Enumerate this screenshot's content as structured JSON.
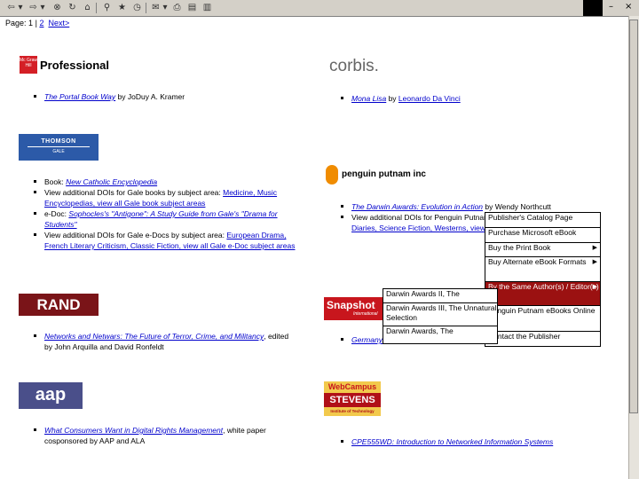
{
  "toolbar": {
    "icons": [
      "back-icon",
      "forward-icon",
      "stop-icon",
      "refresh-icon",
      "home-icon",
      "search-icon",
      "favorites-icon",
      "history-icon",
      "mail-icon",
      "print-icon",
      "edit-icon",
      "discuss-icon"
    ],
    "window_controls": [
      "–",
      "×"
    ]
  },
  "pager": {
    "label": "Page:",
    "page1": "1",
    "sep": "|",
    "page2": "2",
    "next": "Next>"
  },
  "publishers": {
    "mcgraw": {
      "logo_text": "Professional",
      "badge": "Mc Graw Hill",
      "book": "The Portal Book Way",
      "author": " by JoDuy A. Kramer"
    },
    "corbis": {
      "logo_text": "corbis.",
      "book": "Mona Lisa",
      "author_pre": " by ",
      "author": "Leonardo Da Vinci"
    },
    "thomson": {
      "logo_top": "THOMSON",
      "logo_bottom": "GALE",
      "items": [
        {
          "pre": "Book: ",
          "title": "New Catholic Encyclopedia"
        },
        {
          "pre": "View additional DOIs for Gale books by subject area: ",
          "links": "Medicine, Music Encyclopedias, view all Gale book subject areas"
        },
        {
          "pre": "e-Doc: ",
          "title": "Sophocles's \"Antigone\": A Study Guide from Gale's \"Drama for Students\""
        },
        {
          "pre": "View additional DOIs for Gale e-Docs by subject area: ",
          "links": "European Drama, French Literary Criticism, Classic Fiction, view all Gale e-Doc subject areas"
        }
      ]
    },
    "penguin": {
      "logo_text": "penguin putnam inc",
      "items": [
        {
          "title": "The Darwin Awards: Evolution in Action",
          "post": " by Wendy Northcutt"
        },
        {
          "pre": "View additional DOIs for Penguin Putnam ",
          "links": "Diaries, Science Fiction, Westerns, view..."
        }
      ]
    },
    "rand": {
      "logo_text": "RAND",
      "items": [
        {
          "title": "Networks and Netwars: The Future of Terror, Crime, and Militancy",
          "post": ", edited by John Arquilla and David Ronfeldt"
        }
      ]
    },
    "snapshot": {
      "logo_text": "Snapshot",
      "logo_sub": "International",
      "item": "Germany..."
    },
    "aap": {
      "logo_text": "aap",
      "items": [
        {
          "title": "What Consumers Want in Digital Rights Management",
          "post": ", white paper cosponsored by AAP and ALA"
        }
      ]
    },
    "webcampus": {
      "logo_top": "WebCampus",
      "logo_mid": "STEVENS",
      "logo_sub": "Institute of Technology",
      "item": "CPE555WD: Introduction to Networked Information Systems"
    }
  },
  "context_menu": {
    "items": [
      {
        "label": "Publisher's Catalog Page",
        "submenu": false
      },
      {
        "label": "Purchase Microsoft eBook",
        "submenu": false
      },
      {
        "label": "Buy the Print Book",
        "submenu": true
      },
      {
        "label": "Buy Alternate eBook Formats",
        "submenu": true
      },
      {
        "label": "By the Same Author(s) / Editor(s)",
        "submenu": true
      },
      {
        "label": "Penguin Putnam eBooks Online",
        "submenu": false
      },
      {
        "label": "Contact the Publisher",
        "submenu": false
      }
    ],
    "selected_index": 4,
    "accent": "#9b1111"
  },
  "submenu": {
    "items": [
      "Darwin Awards II, The",
      "Darwin Awards III, The Unnatural Selection",
      "Darwin Awards, The"
    ]
  }
}
